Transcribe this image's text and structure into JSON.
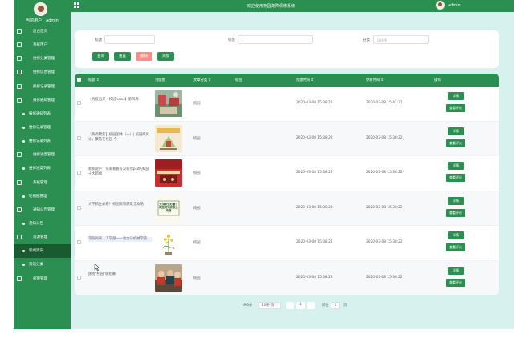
{
  "app": {
    "title": "欢迎使用校园故障保修系统",
    "user": "admin"
  },
  "sidebar": {
    "current_user": "当前用户：admin",
    "items": [
      {
        "label": "后台首页",
        "icon": "home-icon"
      },
      {
        "label": "系统用户",
        "icon": "user-icon"
      },
      {
        "label": "维修分类管理",
        "icon": "category-icon"
      },
      {
        "label": "维修信息管理",
        "icon": "list-icon"
      },
      {
        "label": "报修记录管理",
        "icon": "record-icon"
      },
      {
        "label": "报修通知管理",
        "icon": "bell-icon"
      },
      {
        "label": "报修通知列表",
        "icon": "dot-icon"
      },
      {
        "label": "维修记录管理",
        "icon": "dot-icon"
      },
      {
        "label": "维修记录列表",
        "icon": "dot-icon"
      },
      {
        "label": "维修进度管理",
        "icon": "progress-icon"
      },
      {
        "label": "维修进度列表",
        "icon": "dot-icon"
      },
      {
        "label": "系统管理",
        "icon": "shield-icon"
      },
      {
        "label": "轮播图管理",
        "icon": "dot-icon"
      },
      {
        "label": "通知公告管理",
        "icon": "notice-icon"
      },
      {
        "label": "通知公告",
        "icon": "dot-icon"
      },
      {
        "label": "资源管理",
        "icon": "resource-icon"
      },
      {
        "label": "新闻资讯",
        "icon": "dot-icon"
      },
      {
        "label": "资讯分类",
        "icon": "dot-icon"
      },
      {
        "label": "权限管理",
        "icon": "key-icon"
      }
    ]
  },
  "search": {
    "title_label": "标题",
    "title_placeholder": "",
    "tag_label": "标签",
    "tag_placeholder": "",
    "category_label": "分类",
    "category_placeholder": "请选择",
    "query_button": "查询",
    "reset_button": "重置",
    "delete_button": "删除",
    "add_button": "添加"
  },
  "table": {
    "columns": [
      "标题 ⇕",
      "封面图",
      "文章分类 ⇕",
      "标签",
      "创建时间 ⇕",
      "更新时间 ⇕",
      "操作"
    ],
    "detail_button": "详情",
    "comment_button": "查看评论",
    "rows": [
      {
        "title": "【为疫远开・校园news】第四周",
        "thumb": "photo-campus",
        "category": "校园",
        "tag": "",
        "created": "2020-03-08 15:38:22",
        "updated": "2020-03-08 15:41:31"
      },
      {
        "title": "【热点聚焦】校园团体（一）| 校园好风光，聚焦在校园 今",
        "thumb": "poster-yellow",
        "category": "校园",
        "tag": "",
        "created": "2020-03-08 15:38:22",
        "updated": "2020-03-08 15:38:22"
      },
      {
        "title": "新新说护 | 块来看看有没有你psd的校园十大新闻",
        "thumb": "photo-red-stage",
        "category": "校园",
        "tag": "",
        "created": "2020-03-08 15:38:22",
        "updated": "2020-03-08 15:38:22"
      },
      {
        "title": "大学新生必看！校园资讯获取全攻略",
        "thumb": "poster-guide",
        "category": "校园",
        "tag": "",
        "created": "2020-03-08 15:38:22",
        "updated": "2020-03-08 15:38:22"
      },
      {
        "title": "学院风采丨工学部——动力与机械学院",
        "thumb": "plant-flower",
        "category": "校园",
        "tag": "",
        "created": "2020-03-08 15:38:22",
        "updated": "2020-03-08 15:38:22"
      },
      {
        "title": "国防\"校园\"微招募",
        "thumb": "photo-people",
        "category": "校园",
        "tag": "",
        "created": "2020-03-08 15:38:22",
        "updated": "2020-03-08 15:38:22"
      }
    ],
    "thumb_texts": {
      "poster-guide": "大学新生必看！校园资讯获取全攻略"
    }
  },
  "pagination": {
    "total": "共6条",
    "page_size": "10条/页",
    "prev": "‹",
    "current_page": "1",
    "next": "›",
    "goto_label": "前往",
    "goto_value": "1",
    "goto_suffix": "页"
  }
}
